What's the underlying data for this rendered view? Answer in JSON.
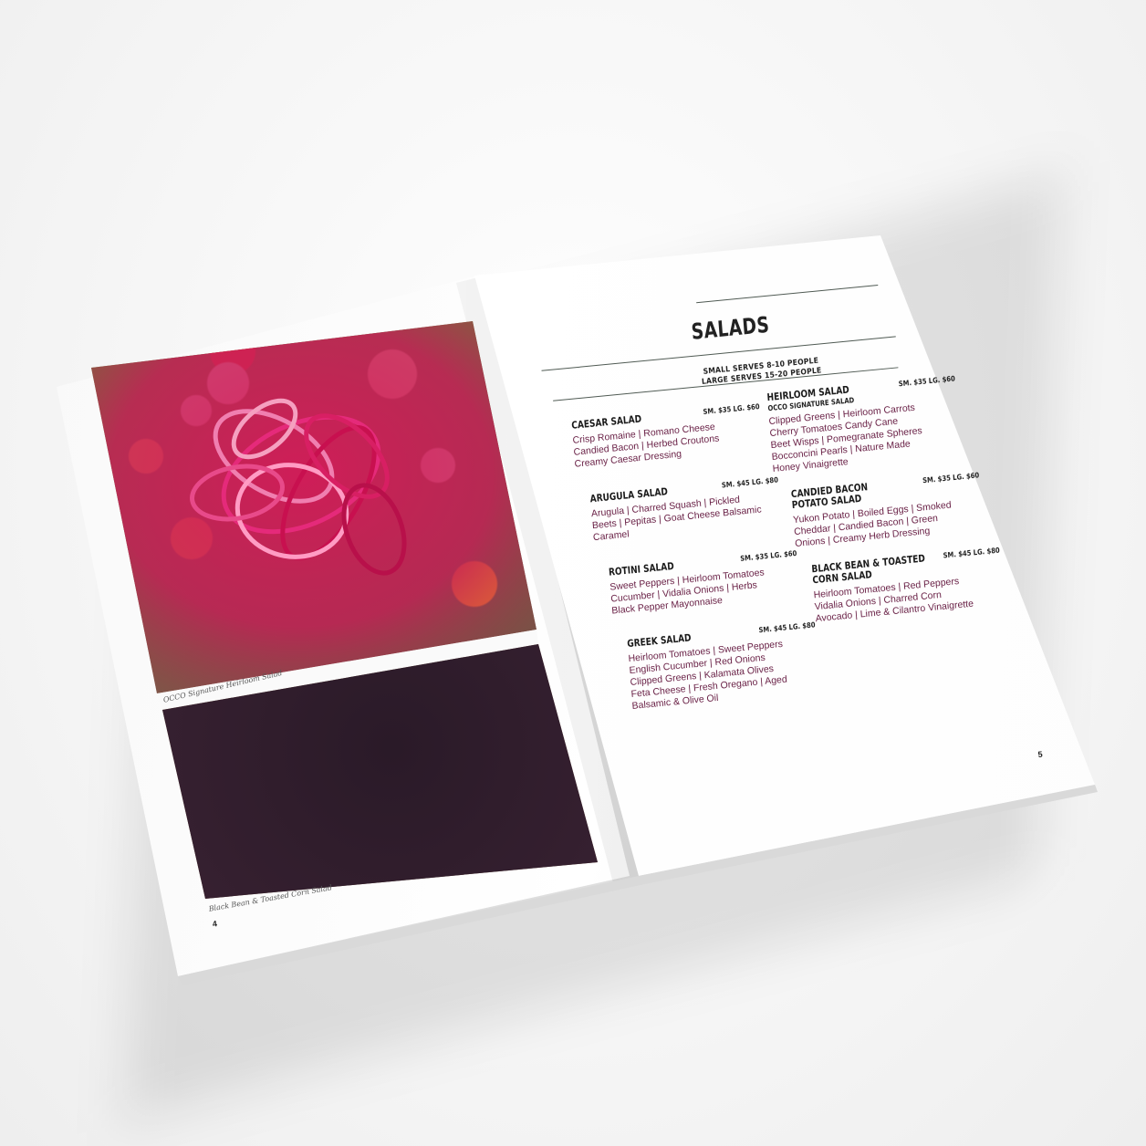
{
  "left": {
    "caption_top": "OCCO Signature Heirloom Salad",
    "caption_bottom": "Black Bean & Toasted Corn Salad",
    "page_number": "4"
  },
  "right": {
    "title": "SALADS",
    "subtitle_1": "SMALL SERVES 8-10 PEOPLE",
    "subtitle_2": "LARGE SERVES 15-20 PEOPLE",
    "page_number": "5",
    "items": [
      {
        "name": "CAESAR SALAD",
        "price": "SM. $35 LG. $60",
        "lines": [
          "Crisp Romaine | Romano Cheese",
          "Candied Bacon | Herbed Croutons",
          "Creamy Caesar Dressing"
        ]
      },
      {
        "name": "ARUGULA SALAD",
        "price": "SM. $45 LG. $80",
        "lines": [
          "Arugula | Charred Squash | Pickled",
          "Beets | Pepitas | Goat Cheese Balsamic",
          "Caramel"
        ]
      },
      {
        "name": "ROTINI SALAD",
        "price": "SM. $35 LG. $60",
        "lines": [
          "Sweet Peppers | Heirloom Tomatoes",
          "Cucumber | Vidalia Onions | Herbs",
          "Black Pepper Mayonnaise"
        ]
      },
      {
        "name": "GREEK SALAD",
        "price": "SM. $45 LG. $80",
        "lines": [
          "Heirloom Tomatoes | Sweet Peppers",
          "English Cucumber | Red Onions",
          "Clipped Greens | Kalamata Olives",
          "Feta Cheese | Fresh Oregano | Aged",
          "Balsamic & Olive Oil"
        ]
      },
      {
        "name": "HEIRLOOM SALAD",
        "tag": "OCCO SIGNATURE SALAD",
        "price": "SM. $35 LG. $60",
        "lines": [
          "Clipped Greens | Heirloom Carrots",
          "Cherry Tomatoes  Candy Cane",
          "Beet Wisps | Pomegranate Spheres",
          "Bocconcini Pearls | Nature Made",
          "Honey Vinaigrette"
        ]
      },
      {
        "name": "CANDIED BACON",
        "name2": "POTATO SALAD",
        "price": "SM. $35 LG. $60",
        "lines": [
          "Yukon Potato | Boiled Eggs | Smoked",
          "Cheddar | Candied Bacon | Green",
          "Onions | Creamy Herb Dressing"
        ]
      },
      {
        "name": "BLACK BEAN & TOASTED",
        "name2": "CORN SALAD",
        "price": "SM. $45 LG. $80",
        "lines": [
          "Heirloom Tomatoes | Red Peppers",
          "Vidalia Onions | Charred Corn",
          "Avocado | Lime & Cilantro Vinaigrette"
        ]
      }
    ]
  }
}
